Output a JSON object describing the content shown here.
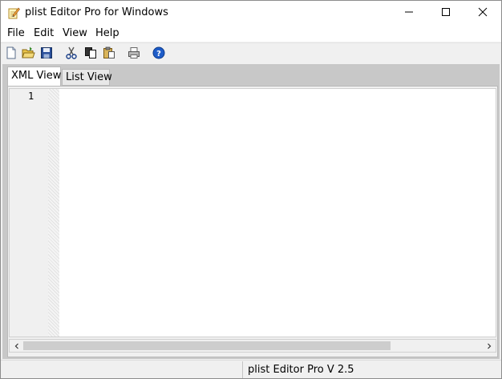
{
  "window": {
    "title": "plist Editor Pro for Windows",
    "icon": "notepad-pencil-icon"
  },
  "title_buttons": {
    "minimize_icon": "minimize-icon",
    "maximize_icon": "maximize-icon",
    "close_icon": "close-icon"
  },
  "menu": {
    "items": [
      {
        "label": "File"
      },
      {
        "label": "Edit"
      },
      {
        "label": "View"
      },
      {
        "label": "Help"
      }
    ]
  },
  "toolbar": {
    "buttons": [
      {
        "icon": "new-file-icon"
      },
      {
        "icon": "open-folder-icon"
      },
      {
        "icon": "save-icon"
      },
      {
        "icon": "cut-icon"
      },
      {
        "icon": "copy-icon"
      },
      {
        "icon": "paste-icon"
      },
      {
        "icon": "print-icon"
      },
      {
        "icon": "help-icon"
      }
    ]
  },
  "tabs": [
    {
      "label": "XML View",
      "active": true
    },
    {
      "label": "List View",
      "active": false
    }
  ],
  "editor": {
    "line_numbers": [
      "1"
    ],
    "content": ""
  },
  "status": {
    "version_text": "plist Editor Pro V 2.5"
  },
  "colors": {
    "chrome": "#f0f0f0",
    "client_background": "#c8c8c8",
    "help_blue": "#1e5cc8",
    "save_blue": "#2a4f9a",
    "folder_yellow": "#e9c44a"
  }
}
